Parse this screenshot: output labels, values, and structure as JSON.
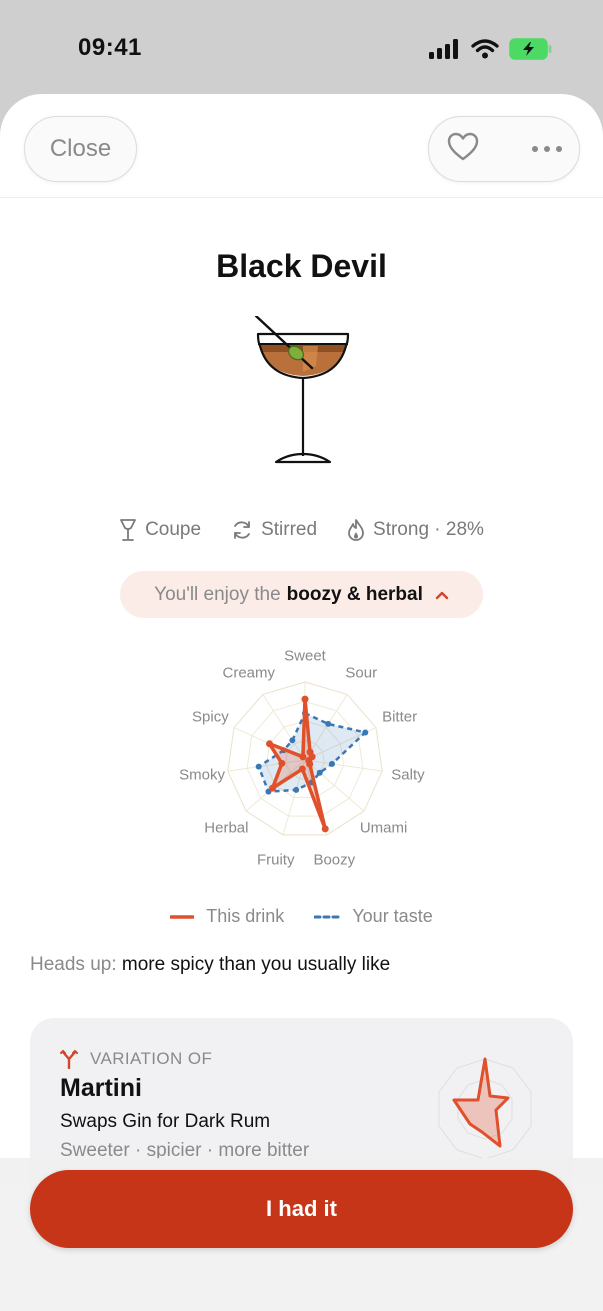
{
  "status": {
    "time": "09:41"
  },
  "header": {
    "close_label": "Close",
    "favorite_icon": "heart-icon",
    "more_icon": "more-dots-icon"
  },
  "drink": {
    "name": "Black Devil",
    "illustration": "coupe-glass-with-olive",
    "glass": "Coupe",
    "method": "Stirred",
    "strength": "Strong · 28%"
  },
  "taste_pill": {
    "prefix": "You'll enjoy the",
    "highlight": "boozy & herbal"
  },
  "radar": {
    "axes": [
      "Sweet",
      "Sour",
      "Bitter",
      "Salty",
      "Umami",
      "Boozy",
      "Fruity",
      "Herbal",
      "Smoky",
      "Spicy",
      "Creamy"
    ],
    "series": [
      {
        "name": "This drink",
        "color": "#e0502b",
        "values": [
          0.78,
          0.12,
          0.1,
          0.05,
          0.08,
          0.92,
          0.12,
          0.55,
          0.3,
          0.5,
          0.05
        ]
      },
      {
        "name": "Your taste",
        "color": "#3a78b5",
        "values": [
          0.6,
          0.55,
          0.85,
          0.35,
          0.25,
          0.3,
          0.4,
          0.62,
          0.6,
          0.3,
          0.3
        ]
      }
    ]
  },
  "legend": {
    "this_drink": "This drink",
    "your_taste": "Your taste"
  },
  "heads_up": {
    "label": "Heads up:",
    "text": "more spicy than you usually like"
  },
  "variation": {
    "kicker": "VARIATION OF",
    "title": "Martini",
    "description": "Swaps Gin for Dark Rum",
    "difference": "Sweeter · spicier · more bitter"
  },
  "cta": {
    "label": "I had it"
  },
  "colors": {
    "accent": "#c63518",
    "this_drink": "#e0502b",
    "your_taste": "#3a78b5",
    "battery": "#4cd964"
  }
}
